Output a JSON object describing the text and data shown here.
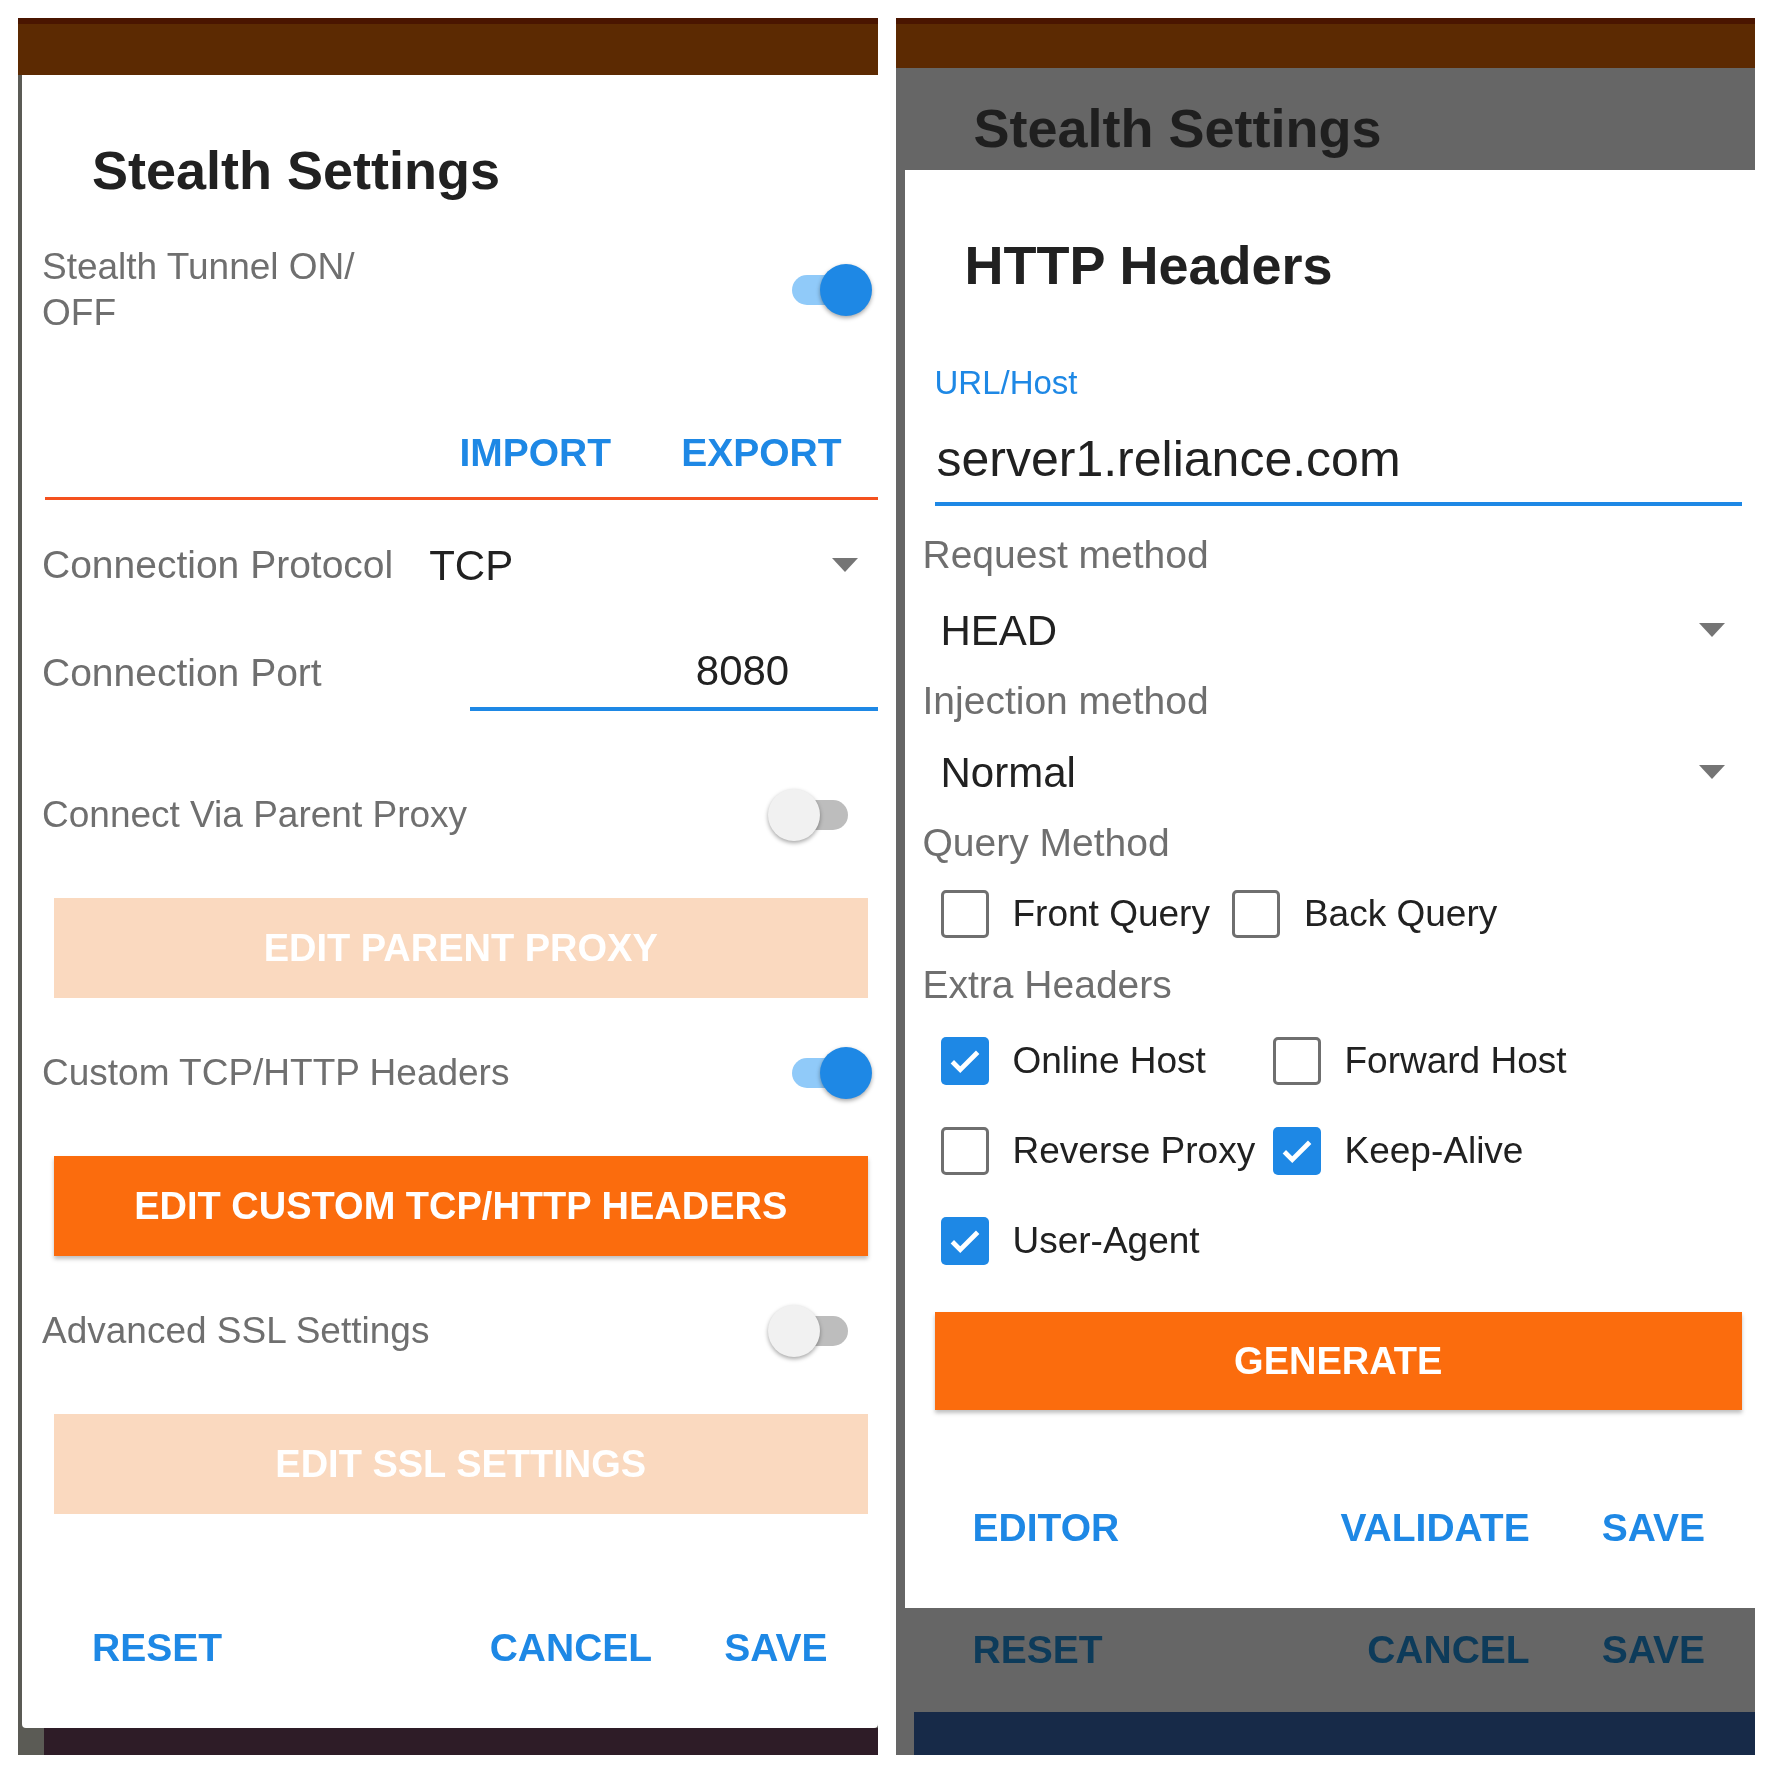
{
  "stealth_dialog": {
    "title": "Stealth Settings",
    "items": [
      {
        "kind": "switch",
        "label": "Stealth Tunnel ON/ OFF",
        "on": true
      },
      {
        "kind": "links",
        "links": [
          "IMPORT",
          "EXPORT"
        ]
      },
      {
        "kind": "select",
        "label": "Connection Protocol",
        "value": "TCP"
      },
      {
        "kind": "input",
        "label": "Connection Port",
        "value": "8080"
      },
      {
        "kind": "switch",
        "label": "Connect Via Parent Proxy",
        "on": false
      },
      {
        "kind": "button",
        "label": "EDIT PARENT PROXY",
        "disabled": true
      },
      {
        "kind": "switch",
        "label": "Custom TCP/HTTP Headers",
        "on": true
      },
      {
        "kind": "button",
        "label": "EDIT CUSTOM TCP/HTTP HEADERS",
        "disabled": false
      },
      {
        "kind": "switch",
        "label": "Advanced SSL Settings",
        "on": false
      },
      {
        "kind": "button",
        "label": "EDIT SSL SETTINGS",
        "disabled": true
      }
    ],
    "actions": [
      "RESET",
      "CANCEL",
      "SAVE"
    ]
  },
  "http_headers_dialog": {
    "background_title": "Stealth Settings",
    "title": "HTTP Headers",
    "url_label": "URL/Host",
    "url_value": "server1.reliance.com",
    "request_method": {
      "label": "Request method",
      "value": "HEAD"
    },
    "injection_method": {
      "label": "Injection method",
      "value": "Normal"
    },
    "query_method": {
      "label": "Query Method",
      "options": [
        {
          "label": "Front Query",
          "checked": false
        },
        {
          "label": "Back Query",
          "checked": false
        }
      ]
    },
    "extra_headers": {
      "label": "Extra Headers",
      "options": [
        {
          "label": "Online Host",
          "checked": true
        },
        {
          "label": "Forward Host",
          "checked": false
        },
        {
          "label": "Reverse Proxy",
          "checked": false
        },
        {
          "label": "Keep-Alive",
          "checked": true
        },
        {
          "label": "User-Agent",
          "checked": true
        }
      ]
    },
    "generate": "GENERATE",
    "actions": [
      "EDITOR",
      "VALIDATE",
      "SAVE"
    ],
    "background_actions": [
      "RESET",
      "CANCEL",
      "SAVE"
    ]
  }
}
